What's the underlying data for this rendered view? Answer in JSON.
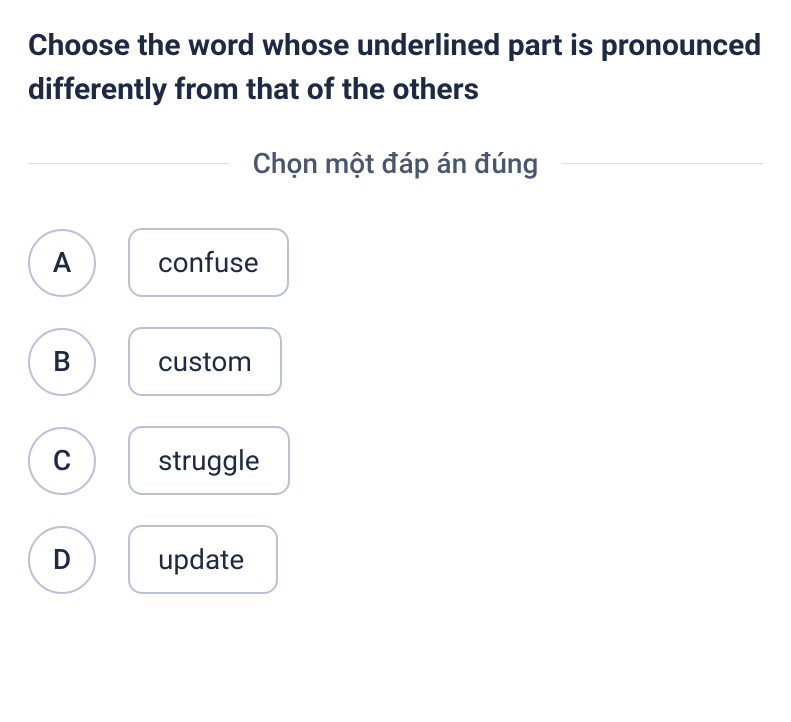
{
  "question": "Choose the word whose underlined part is pronounced differently from that of the others",
  "instruction": "Chọn một đáp án đúng",
  "options": [
    {
      "letter": "A",
      "word": "confuse"
    },
    {
      "letter": "B",
      "word": "custom"
    },
    {
      "letter": "C",
      "word": "struggle"
    },
    {
      "letter": "D",
      "word": "update"
    }
  ]
}
